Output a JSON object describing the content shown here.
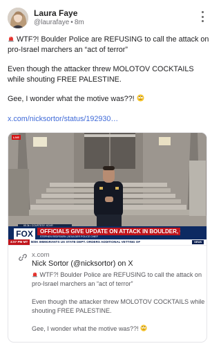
{
  "author": {
    "name": "Laura Faye",
    "handle": "@laurafaye",
    "separator": "•",
    "time": "8m"
  },
  "post": {
    "paragraph_1": "WTF?! Boulder Police are REFUSING to call the attack on pro-Israel marchers an “act of terror”",
    "paragraph_2": "Even though the attacker threw MOLOTOV COCKTAILS while shouting FREE PALESTINE.",
    "paragraph_3": "Gee, I wonder what the motive was??!",
    "link": "x.com/nicksortor/status/192930…"
  },
  "card": {
    "domain": "x.com",
    "title": "Nick Sortor (@nicksortor) on X",
    "desc_1": "WTF?! Boulder Police are REFUSING to call the attack on pro-Israel marchers an “act of terror”",
    "desc_2": "Even though the attacker threw MOLOTOV COCKTAILS while shouting FREE PALESTINE.",
    "desc_3": "Gee, I wonder what the motive was??!"
  },
  "video": {
    "live": "LIVE",
    "topstrip": "65.3k • COURTESY: KDVR",
    "channel": "FOX",
    "headline": "OFFICIALS GIVE UPDATE ON ATTACK IN BOULDER, CO",
    "subline": "STEPHEN REDFEARN | BOULDER POLICE CHIEF",
    "time": "4:07 PM MT",
    "ticker": "500K IMMIGRANTS   US STATE DEPT. ORDERS ADDITIONAL VETTING OF",
    "newsbox": "NEWS"
  },
  "icons": {
    "siren": "police-car-light-emoji",
    "eyeroll": "face-with-rolling-eyes-emoji",
    "more": "vertical-ellipsis-icon",
    "link": "link-icon"
  },
  "colors": {
    "link": "#3f6ad8",
    "fox_navy": "#0d2a62",
    "fox_red": "#c0141b"
  }
}
